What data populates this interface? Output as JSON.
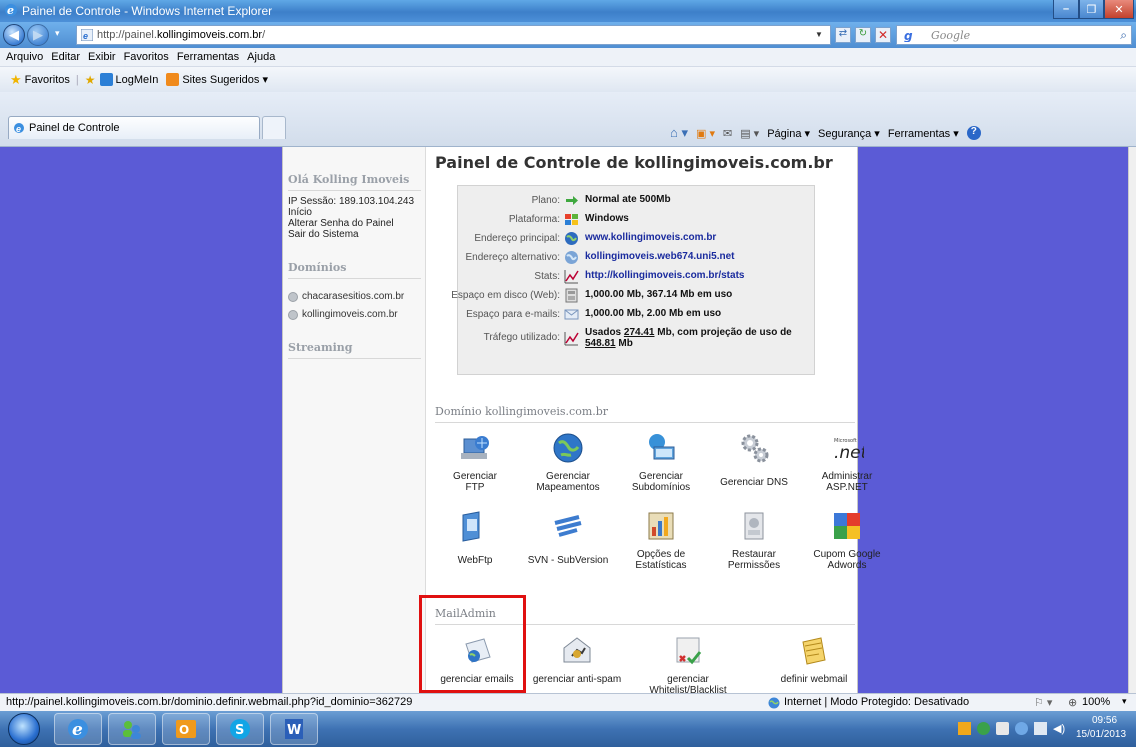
{
  "window": {
    "title": "Painel de Controle - Windows Internet Explorer"
  },
  "address": {
    "url_prefix": "http://painel.",
    "url_domain": "kollingimoveis.com.br",
    "url_suffix": "/"
  },
  "search": {
    "placeholder": "Google"
  },
  "menu": [
    "Arquivo",
    "Editar",
    "Exibir",
    "Favoritos",
    "Ferramentas",
    "Ajuda"
  ],
  "favorites": {
    "label": "Favoritos",
    "items": [
      "LogMeIn",
      "Sites Sugeridos ▾"
    ]
  },
  "tab": {
    "label": "Painel de Controle"
  },
  "commands": {
    "page": "Página ▾",
    "security": "Segurança ▾",
    "tools": "Ferramentas ▾"
  },
  "sidebar": {
    "greeting": "Olá Kolling Imoveis",
    "ip": "IP Sessão: 189.103.104.243",
    "links": [
      "Início",
      "Alterar Senha do Painel",
      "Sair do Sistema"
    ],
    "domains_title": "Domínios",
    "domains": [
      "chacarasesitios.com.br",
      "kollingimoveis.com.br"
    ],
    "streaming_title": "Streaming"
  },
  "main": {
    "title": "Painel de Controle de kollingimoveis.com.br"
  },
  "info": [
    {
      "label": "Plano:",
      "value": "Normal ate 500Mb"
    },
    {
      "label": "Plataforma:",
      "value": "Windows"
    },
    {
      "label": "Endereço principal:",
      "value": "www.kollingimoveis.com.br"
    },
    {
      "label": "Endereço alternativo:",
      "value": "kollingimoveis.web674.uni5.net"
    },
    {
      "label": "Stats:",
      "value": "http://kollingimoveis.com.br/stats"
    },
    {
      "label": "Espaço em disco (Web):",
      "value": "1,000.00 Mb, 367.14 Mb em uso"
    },
    {
      "label": "Espaço para e-mails:",
      "value": "1,000.00 Mb, 2.00 Mb em uso"
    },
    {
      "label": "Tráfego utilizado:",
      "value_a": "Usados ",
      "value_b": "274.41",
      "value_c": " Mb, com projeção de uso de ",
      "value_d": "548.81",
      "value_e": "Mb"
    }
  ],
  "domain_section": {
    "title": "Domínio kollingimoveis.com.br"
  },
  "tools": [
    "Gerenciar\nFTP",
    "Gerenciar\nMapeamentos",
    "Gerenciar\nSubdomínios",
    "Gerenciar DNS",
    "Administrar\nASP.NET",
    "WebFtp",
    "SVN - SubVersion",
    "Opções de\nEstatísticas",
    "Restaurar\nPermissões",
    "Cupom Google\nAdwords"
  ],
  "mail_section": {
    "title": "MailAdmin",
    "items": [
      "gerenciar emails",
      "gerenciar anti-spam",
      "gerenciar Whitelist/Blacklist",
      "definir webmail"
    ]
  },
  "status": {
    "link": "http://painel.kollingimoveis.com.br/dominio.definir.webmail.php?id_dominio=362729",
    "zone": "Internet | Modo Protegido: Desativado",
    "zoom": "100%"
  },
  "tray": {
    "time": "09:56",
    "date": "15/01/2013"
  }
}
